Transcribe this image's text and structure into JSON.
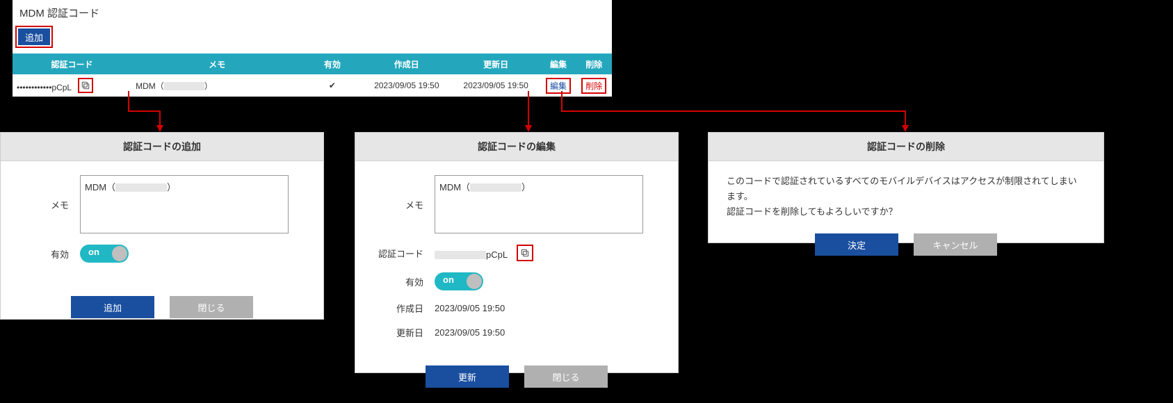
{
  "title": "MDM 認証コード",
  "addBtn": "追加",
  "headers": {
    "code": "認証コード",
    "memo": "メモ",
    "valid": "有効",
    "created": "作成日",
    "updated": "更新日",
    "edit": "編集",
    "del": "削除"
  },
  "row": {
    "code_masked": "••••••••••••pCpL",
    "memo_prefix": "MDM（",
    "memo_suffix": "）",
    "check": "✔",
    "created": "2023/09/05 19:50",
    "updated": "2023/09/05 19:50",
    "edit": "編集",
    "del": "削除"
  },
  "modalAdd": {
    "title": "認証コードの追加",
    "memoLabel": "メモ",
    "memo_prefix": "MDM（",
    "memo_suffix": "）",
    "validLabel": "有効",
    "toggleText": "on",
    "btnAdd": "追加",
    "btnClose": "閉じる"
  },
  "modalEdit": {
    "title": "認証コードの編集",
    "memoLabel": "メモ",
    "memo_prefix": "MDM（",
    "memo_suffix": "）",
    "codeLabel": "認証コード",
    "code_suffix": "pCpL",
    "validLabel": "有効",
    "toggleText": "on",
    "createdLabel": "作成日",
    "created": "2023/09/05 19:50",
    "updatedLabel": "更新日",
    "updated": "2023/09/05 19:50",
    "btnUpdate": "更新",
    "btnClose": "閉じる"
  },
  "modalDel": {
    "title": "認証コードの削除",
    "msg1": "このコードで認証されているすべてのモバイルデバイスはアクセスが制限されてしまいます。",
    "msg2": "認証コードを削除してもよろしいですか？",
    "btnOk": "決定",
    "btnCancel": "キャンセル"
  }
}
